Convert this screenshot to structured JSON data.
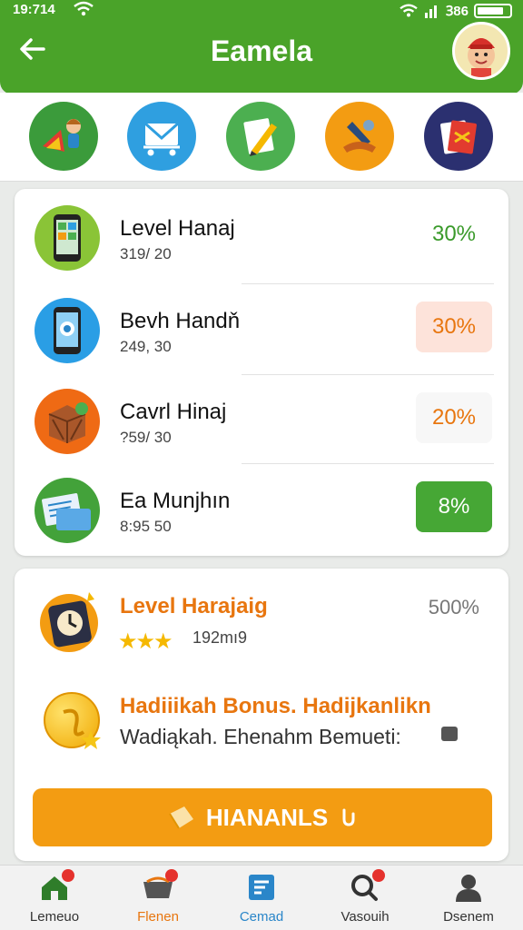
{
  "status": {
    "time": "19:714",
    "battery_text": "Ꝫ86"
  },
  "header": {
    "title": "Eamela"
  },
  "categories": [
    {
      "icon": "kids-icon",
      "color": "#3b9b3b"
    },
    {
      "icon": "cart-icon",
      "color": "#2f9fe0"
    },
    {
      "icon": "pencil-icon",
      "color": "#4caf50"
    },
    {
      "icon": "tools-icon",
      "color": "#f39c12"
    },
    {
      "icon": "cards-icon",
      "color": "#2b3070"
    }
  ],
  "levels": [
    {
      "name": "Level Hanaj",
      "sub": "319/ 20",
      "percent": "30%",
      "icon": "phone-icon",
      "icon_bg": "#8ac437",
      "pct_color": "#3a9a2a",
      "pct_bg": "#ffffff"
    },
    {
      "name": "Bevh Handň",
      "sub": "249, 30",
      "percent": "30%",
      "icon": "mobile-icon",
      "icon_bg": "#2a9ee5",
      "pct_color": "#e8760f",
      "pct_bg": "#fde3da"
    },
    {
      "name": "Cavrl Hinaj",
      "sub": "?59/ 30",
      "percent": "20%",
      "icon": "crate-icon",
      "icon_bg": "#ef6a14",
      "pct_color": "#e8760f",
      "pct_bg": "#f7f7f7"
    },
    {
      "name": "Ea Munjhın",
      "sub": "8:95 50",
      "percent": "8%",
      "icon": "document-icon",
      "icon_bg": "#43a23a",
      "pct_color": "#ffffff",
      "pct_bg": "#46a735"
    }
  ],
  "bonus": {
    "level_title": "Level Harajaig",
    "level_percent": "500%",
    "stars": "★★★",
    "stars_sub": "192mı9",
    "head": "Hadiiikah Bonus. Hadijkanlikn",
    "desc": "Wadiąkah. Ehenahm Bemueti:",
    "claim_label": "HIANANLS"
  },
  "nav": [
    {
      "label": "Lemeuo",
      "icon": "home-icon",
      "color": "#2f7d2a",
      "badge": true
    },
    {
      "label": "Flenen",
      "icon": "basket-icon",
      "color": "#e8760f",
      "badge": true
    },
    {
      "label": "Cemad",
      "icon": "document-icon",
      "color": "#2a86c9",
      "badge": false
    },
    {
      "label": "Vasouih",
      "icon": "search-icon",
      "color": "#333333",
      "badge": true
    },
    {
      "label": "Dsenem",
      "icon": "user-icon",
      "color": "#333333",
      "badge": false
    }
  ]
}
